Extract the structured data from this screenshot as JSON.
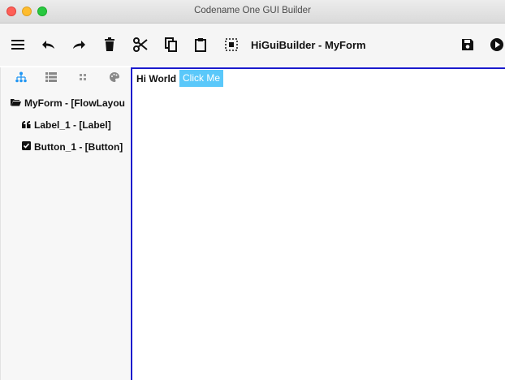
{
  "window": {
    "title": "Codename One GUI Builder"
  },
  "toolbar": {
    "title": "HiGuiBuilder - MyForm",
    "icons": [
      "menu-icon",
      "undo-icon",
      "redo-icon",
      "delete-icon",
      "cut-icon",
      "copy-icon",
      "paste-icon",
      "select-icon",
      "save-icon",
      "run-icon"
    ]
  },
  "sidebar": {
    "tabs": [
      "hierarchy-icon",
      "list-icon",
      "components-icon",
      "palette-icon"
    ],
    "tree": [
      {
        "label": "MyForm - [FlowLayou",
        "icon": "folder-icon"
      },
      {
        "label": "Label_1 - [Label]",
        "icon": "quote-icon"
      },
      {
        "label": "Button_1 - [Button]",
        "icon": "checkbox-icon"
      }
    ]
  },
  "canvas": {
    "label_text": "Hi World",
    "button_text": "Click Me"
  },
  "colors": {
    "accent": "#2196f3",
    "canvas_border": "#1a1acc",
    "button_bg": "#5ac8fa"
  }
}
